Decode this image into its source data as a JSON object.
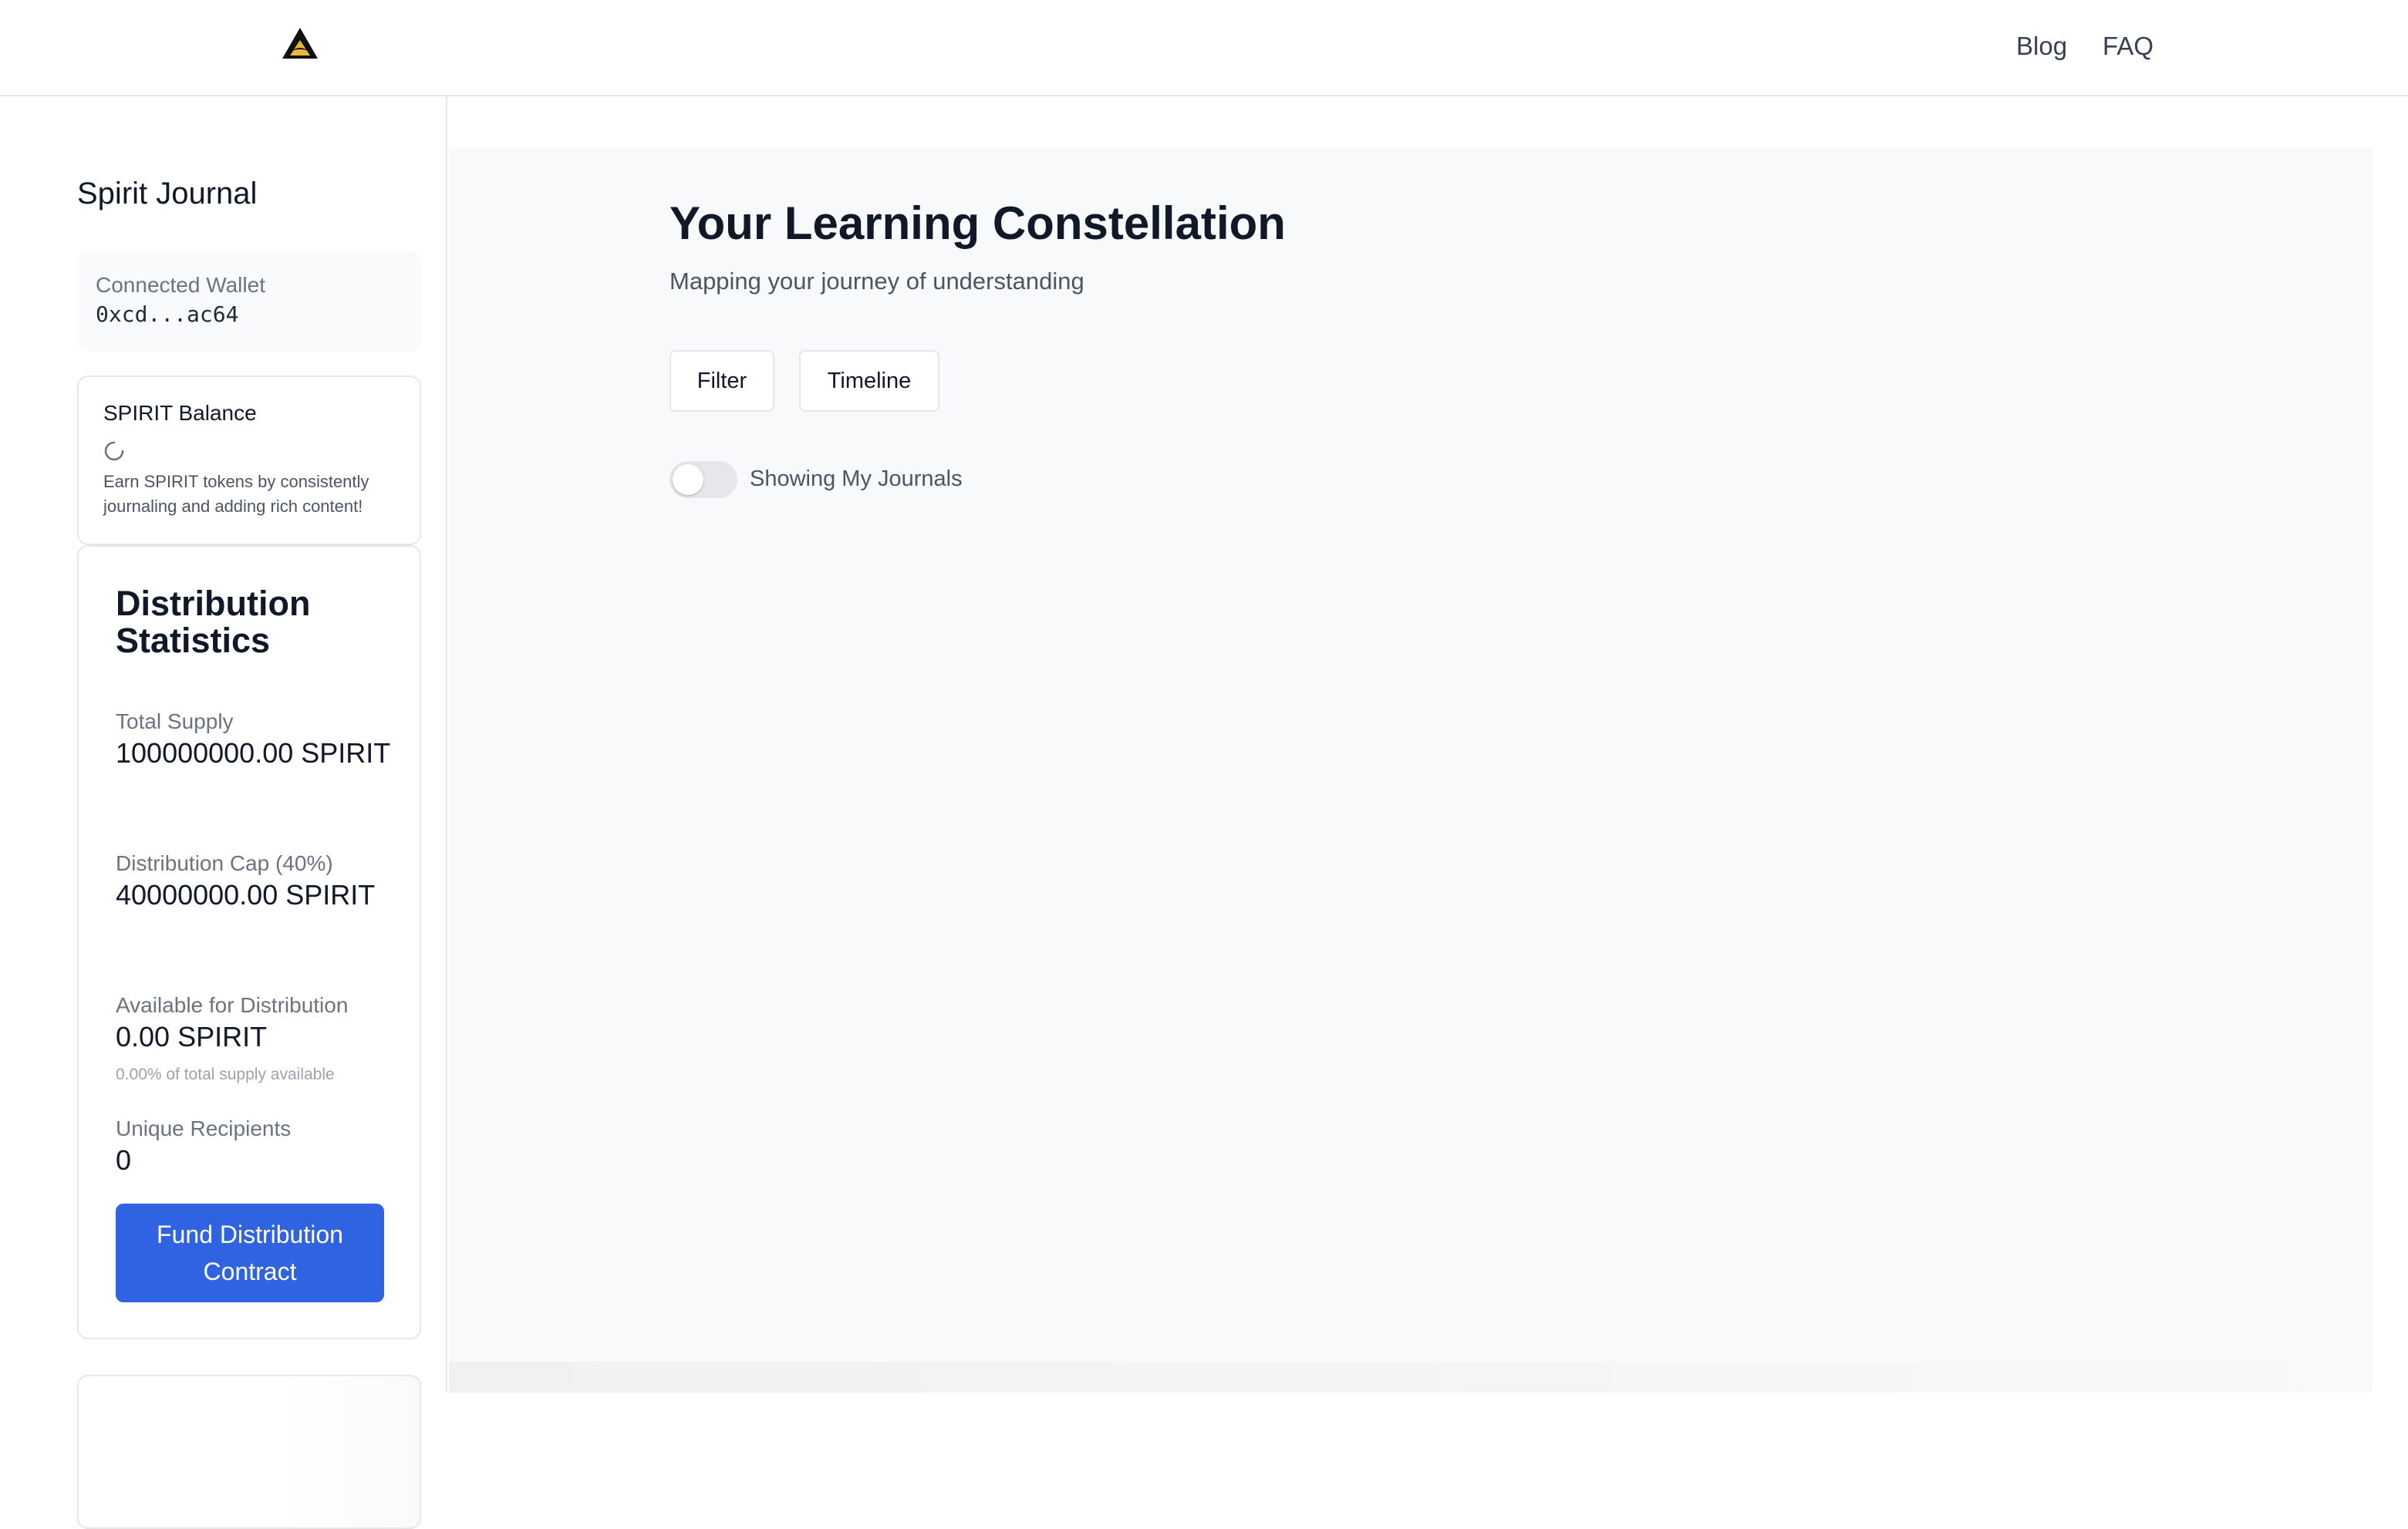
{
  "header": {
    "logo_name": "triangle-logo-icon",
    "nav": [
      {
        "label": "Blog"
      },
      {
        "label": "FAQ"
      }
    ]
  },
  "sidebar": {
    "title": "Spirit Journal",
    "wallet": {
      "label": "Connected Wallet",
      "address": "0xcd...ac64"
    },
    "balance": {
      "title": "SPIRIT Balance",
      "description": "Earn SPIRIT tokens by consistently journaling and adding rich content!"
    },
    "stats": {
      "title": "Distribution Statistics",
      "total_supply_label": "Total Supply",
      "total_supply_value": "100000000.00 SPIRIT",
      "cap_label": "Distribution Cap (40%)",
      "cap_value": "40000000.00 SPIRIT",
      "available_label": "Available for Distribution",
      "available_value": "0.00 SPIRIT",
      "available_note": "0.00% of total supply available",
      "recipients_label": "Unique Recipients",
      "recipients_value": "0",
      "fund_button": "Fund Distribution Contract"
    }
  },
  "main": {
    "title": "Your Learning Constellation",
    "subtitle": "Mapping your journey of understanding",
    "filter_button": "Filter",
    "timeline_button": "Timeline",
    "toggle_label": "Showing My Journals",
    "toggle_on": false
  },
  "colors": {
    "primary": "#2f63e2",
    "main_background": "#f8f9fb",
    "border": "#e5e7eb"
  }
}
